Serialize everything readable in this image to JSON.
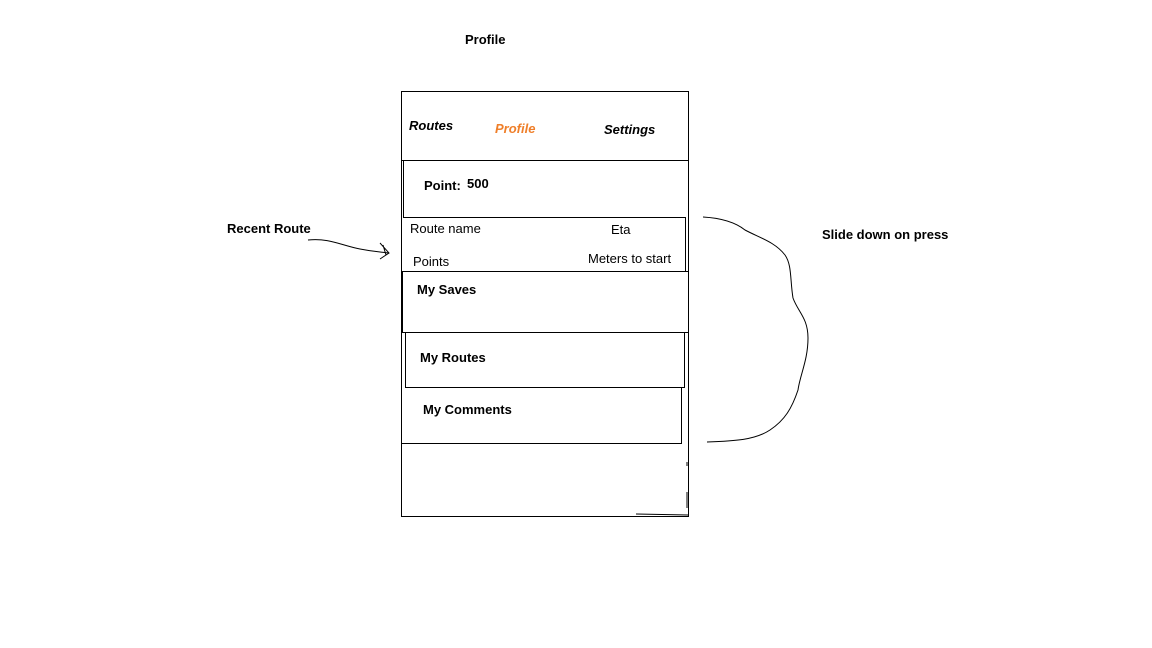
{
  "page": {
    "title": "Profile"
  },
  "tabs": {
    "routes": "Routes",
    "profile": "Profile",
    "settings": "Settings",
    "active_color": "#ef7f2a"
  },
  "points": {
    "label": "Point:",
    "value": "500"
  },
  "recent_route": {
    "name_label": "Route name",
    "eta_label": "Eta",
    "points_label": "Points",
    "meters_label": "Meters to start"
  },
  "sections": {
    "my_saves": "My Saves",
    "my_routes": "My Routes",
    "my_comments": "My Comments"
  },
  "annotations": {
    "recent_route": "Recent Route",
    "slide_down": "Slide down on press"
  }
}
